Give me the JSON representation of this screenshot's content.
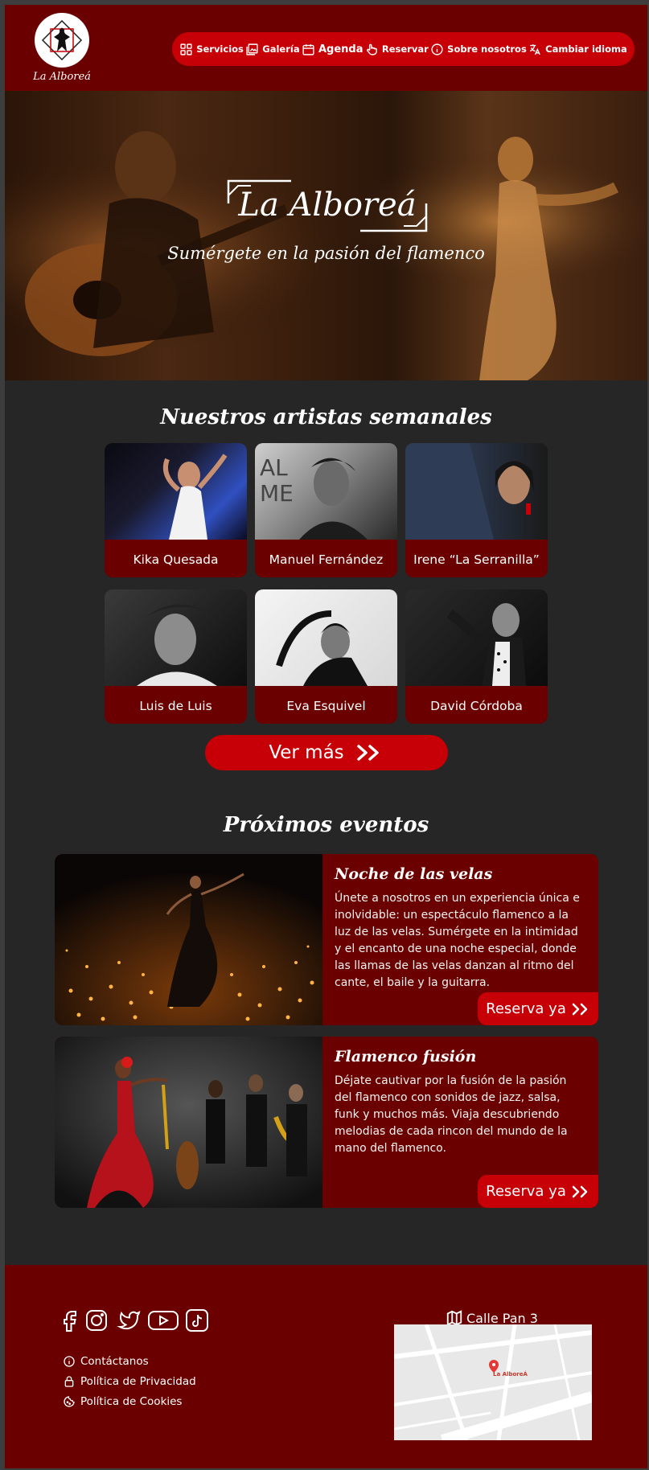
{
  "brand": {
    "name": "La Alboreá"
  },
  "nav": {
    "items": [
      {
        "label": "Servicios",
        "icon": "grid-icon"
      },
      {
        "label": "Galería",
        "icon": "gallery-icon"
      },
      {
        "label": "Agenda",
        "icon": "calendar-icon"
      },
      {
        "label": "Reservar",
        "icon": "hand-pointer-icon"
      },
      {
        "label": "Sobre nosotros",
        "icon": "info-icon"
      },
      {
        "label": "Cambiar idioma",
        "icon": "translate-icon"
      }
    ]
  },
  "hero": {
    "title": "La Alboreá",
    "subtitle": "Sumérgete en la pasión del flamenco"
  },
  "artists": {
    "title": "Nuestros artistas semanales",
    "items": [
      {
        "name": "Kika Quesada"
      },
      {
        "name": "Manuel Fernández"
      },
      {
        "name": "Irene “La Serranilla”"
      },
      {
        "name": "Luis de Luis"
      },
      {
        "name": "Eva Esquivel"
      },
      {
        "name": "David Córdoba"
      }
    ],
    "more_label": "Ver más"
  },
  "events": {
    "title": "Próximos eventos",
    "items": [
      {
        "title": "Noche de las velas",
        "text": "Únete a nosotros en un experiencia única e inolvidable: un espectáculo flamenco a la luz de las velas. Sumérgete en la intimidad y el encanto de una noche especial, donde las llamas de las velas danzan al ritmo del cante, el baile y la guitarra.",
        "button": "Reserva ya"
      },
      {
        "title": "Flamenco fusión",
        "text": "Déjate cautivar por la fusión de la pasión del flamenco con sonidos de jazz, salsa, funk y muchos más. Viaja descubriendo melodias de cada rincon del mundo de la mano del flamenco.",
        "button": "Reserva ya"
      }
    ]
  },
  "footer": {
    "social_icons": [
      "facebook-icon",
      "instagram-icon",
      "twitter-icon",
      "youtube-icon",
      "tiktok-icon"
    ],
    "links": [
      {
        "label": "Contáctanos",
        "icon": "info-icon"
      },
      {
        "label": "Política de Privacidad",
        "icon": "lock-icon"
      },
      {
        "label": "Política de Cookies",
        "icon": "cookie-icon"
      }
    ],
    "address": "Calle Pan 3",
    "map_label": "La AlboreÁ"
  },
  "colors": {
    "dark_red": "#6b0000",
    "accent_red": "#c70007",
    "background": "#262626"
  }
}
